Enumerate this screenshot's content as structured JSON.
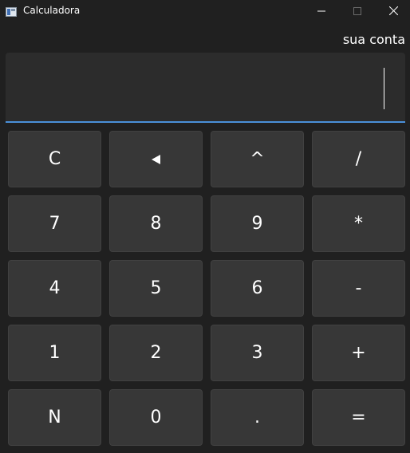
{
  "window": {
    "title": "Calculadora",
    "icon": "calculator-app-icon",
    "controls": [
      "minimize-icon",
      "maximize-icon",
      "close-icon"
    ]
  },
  "header": {
    "subtitle": "sua conta"
  },
  "display": {
    "value": ""
  },
  "keys": [
    {
      "label": "C",
      "name": "clear-button"
    },
    {
      "label": "◄",
      "name": "backspace-button"
    },
    {
      "label": "^",
      "name": "power-button"
    },
    {
      "label": "/",
      "name": "divide-button"
    },
    {
      "label": "7",
      "name": "digit-7-button"
    },
    {
      "label": "8",
      "name": "digit-8-button"
    },
    {
      "label": "9",
      "name": "digit-9-button"
    },
    {
      "label": "*",
      "name": "multiply-button"
    },
    {
      "label": "4",
      "name": "digit-4-button"
    },
    {
      "label": "5",
      "name": "digit-5-button"
    },
    {
      "label": "6",
      "name": "digit-6-button"
    },
    {
      "label": "-",
      "name": "subtract-button"
    },
    {
      "label": "1",
      "name": "digit-1-button"
    },
    {
      "label": "2",
      "name": "digit-2-button"
    },
    {
      "label": "3",
      "name": "digit-3-button"
    },
    {
      "label": "+",
      "name": "add-button"
    },
    {
      "label": "N",
      "name": "negate-button"
    },
    {
      "label": "0",
      "name": "digit-0-button"
    },
    {
      "label": ".",
      "name": "decimal-button"
    },
    {
      "label": "=",
      "name": "equals-button"
    }
  ],
  "colors": {
    "background": "#202020",
    "display": "#2c2c2c",
    "key": "#373737",
    "accent": "#4a90d9"
  }
}
